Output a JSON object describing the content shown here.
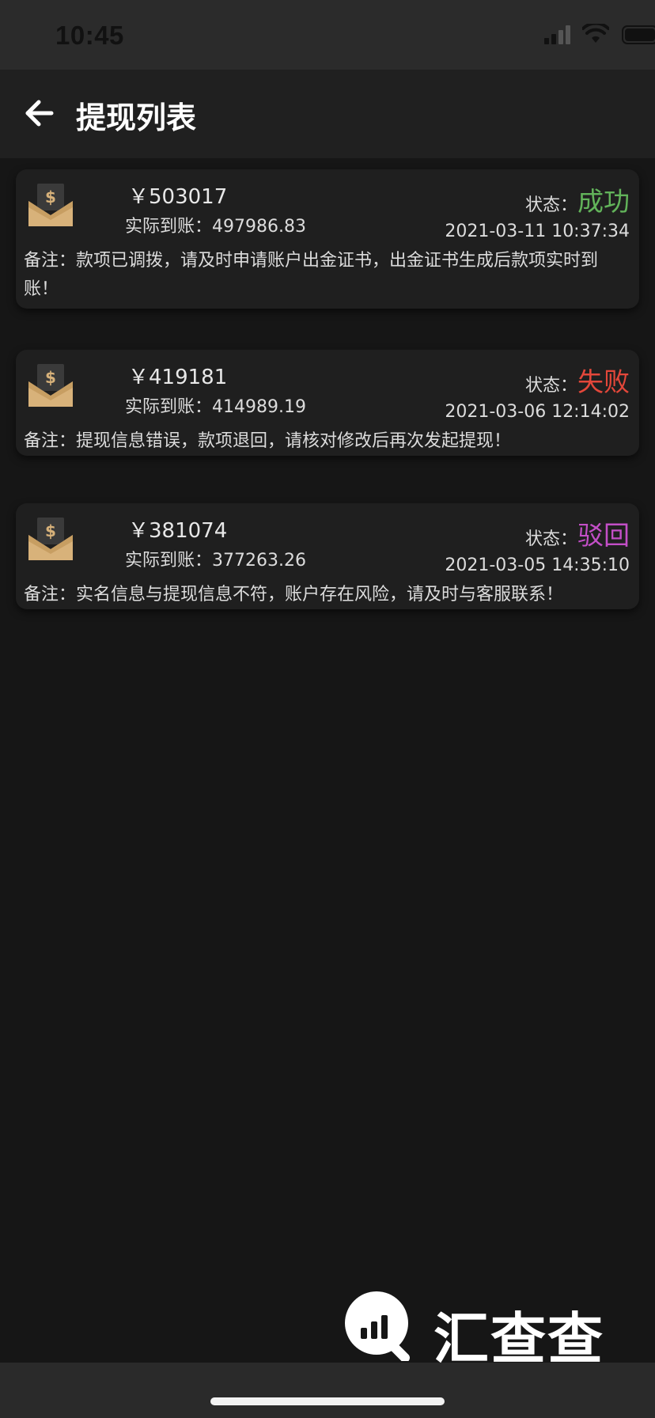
{
  "status_bar": {
    "time": "10:45"
  },
  "header": {
    "title": "提现列表"
  },
  "cards": [
    {
      "amount": "￥503017",
      "actual_label": "实际到账：",
      "actual_value": "497986.83",
      "status_label": "状态：",
      "status_value": "成功",
      "status_color": "#62b35a",
      "datetime": "2021-03-11 10:37:34",
      "remark_label": "备注：",
      "remark": "款项已调拨，请及时申请账户出金证书，出金证书生成后款项实时到账！"
    },
    {
      "amount": "￥419181",
      "actual_label": "实际到账：",
      "actual_value": "414989.19",
      "status_label": "状态：",
      "status_value": "失败",
      "status_color": "#e3473a",
      "datetime": "2021-03-06 12:14:02",
      "remark_label": "备注：",
      "remark": "提现信息错误，款项退回，请核对修改后再次发起提现！"
    },
    {
      "amount": "￥381074",
      "actual_label": "实际到账：",
      "actual_value": "377263.26",
      "status_label": "状态：",
      "status_value": "驳回",
      "status_color": "#c34fc7",
      "datetime": "2021-03-05 14:35:10",
      "remark_label": "备注：",
      "remark": "实名信息与提现信息不符，账户存在风险，请及时与客服联系！"
    }
  ],
  "watermark": {
    "text": "汇查查"
  },
  "icons": {
    "back": "arrow-left-icon",
    "card": "money-envelope-icon",
    "signal": "cellular-signal-icon",
    "wifi": "wifi-icon",
    "battery": "battery-icon",
    "watermark_logo": "chart-magnifier-logo"
  }
}
